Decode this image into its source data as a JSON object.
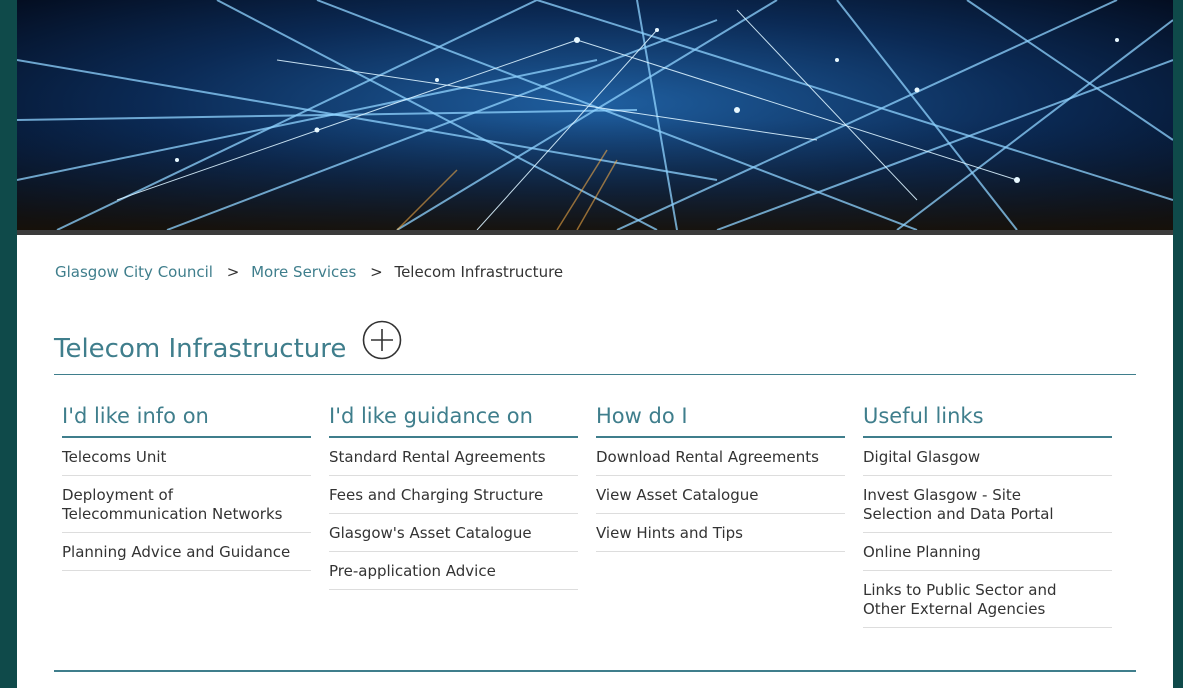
{
  "breadcrumb": {
    "items": [
      "Glasgow City Council",
      "More Services"
    ],
    "current": "Telecom Infrastructure",
    "separator": ">"
  },
  "page": {
    "title": "Telecom Infrastructure",
    "add_icon": "plus-circle-icon"
  },
  "columns": [
    {
      "heading": "I'd like info on",
      "links": [
        "Telecoms Unit",
        "Deployment of\nTelecommunication Networks",
        "Planning Advice and Guidance"
      ]
    },
    {
      "heading": "I'd like guidance on",
      "links": [
        "Standard Rental Agreements",
        "Fees and Charging Structure",
        "Glasgow's Asset Catalogue",
        "Pre-application Advice"
      ]
    },
    {
      "heading": "How do I",
      "links": [
        "Download Rental Agreements",
        "View Asset Catalogue",
        "View Hints and Tips"
      ]
    },
    {
      "heading": "Useful links",
      "links": [
        "Digital Glasgow",
        "Invest Glasgow - Site\nSelection and Data Portal",
        "Online Planning",
        "Links to Public Sector and\nOther External Agencies"
      ]
    }
  ],
  "colors": {
    "accent": "#3f7e8c",
    "text": "#333333",
    "page_bg": "#0f4a4a"
  }
}
